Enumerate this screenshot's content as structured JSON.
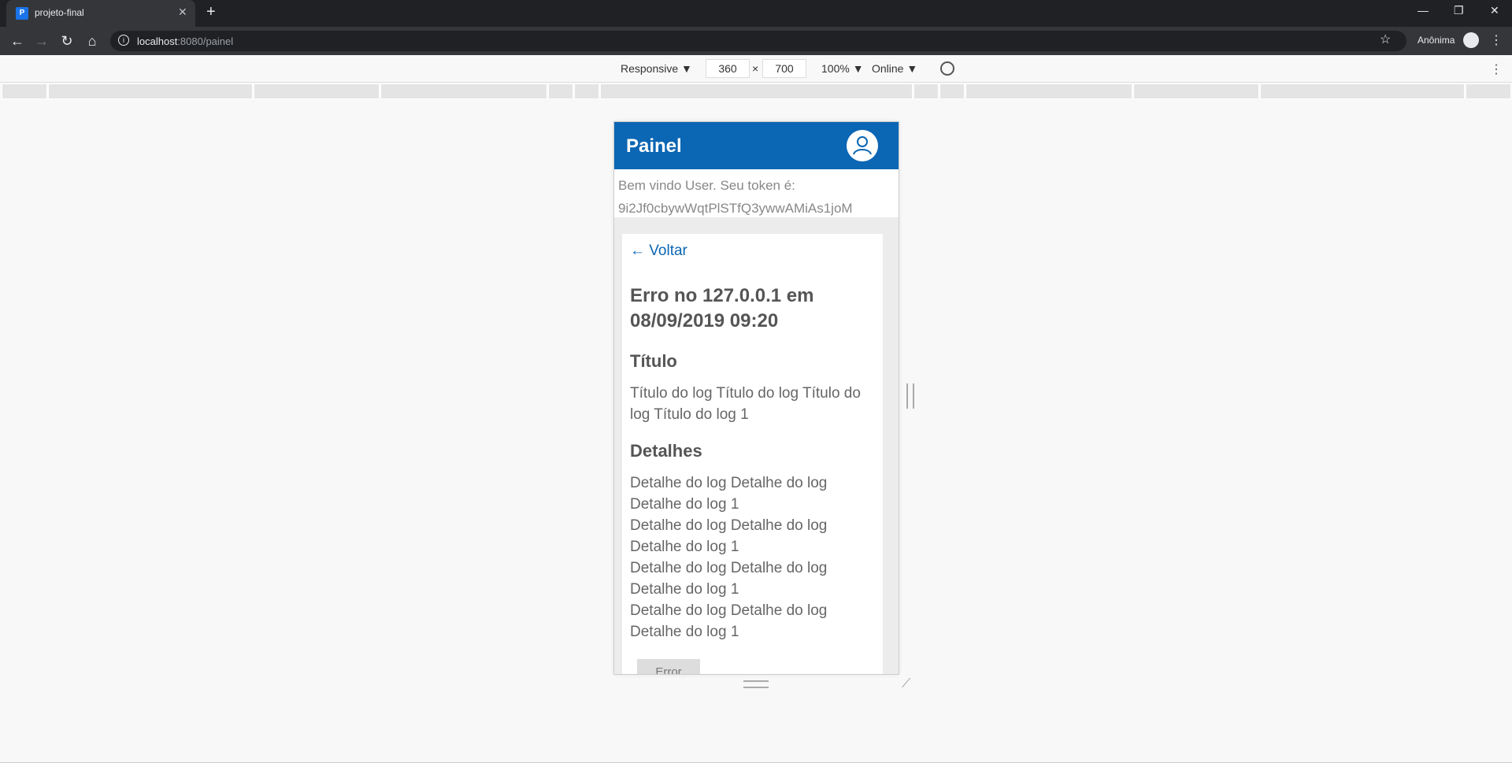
{
  "browser": {
    "tab_title": "projeto-final",
    "favicon_letter": "P",
    "url_host": "localhost",
    "url_rest": ":8080/painel",
    "profile_label": "Anônima"
  },
  "devtools": {
    "device": "Responsive ▼",
    "width": "360",
    "x": "×",
    "height": "700",
    "zoom": "100% ▼",
    "network": "Online ▼"
  },
  "app": {
    "title": "Painel",
    "welcome_line1": "Bem vindo User. Seu token é:",
    "welcome_line2": "9i2Jf0cbywWqtPlSTfQ3ywwAMiAs1joM",
    "back_label": "← Voltar",
    "error_heading": "Erro no 127.0.0.1 em 08/09/2019 09:20",
    "titulo_heading": "Título",
    "titulo_text": "Título do log Título do log Título do log Título do log 1",
    "detalhes_heading": "Detalhes",
    "detalhes_lines": [
      "Detalhe do log Detalhe do log Detalhe do log 1",
      "Detalhe do log Detalhe do log Detalhe do log 1",
      "Detalhe do log Detalhe do log Detalhe do log 1",
      "Detalhe do log Detalhe do log Detalhe do log 1"
    ],
    "level_tag": "Error"
  },
  "colors": {
    "primary": "#0b66b3",
    "chrome_dark": "#202124"
  }
}
